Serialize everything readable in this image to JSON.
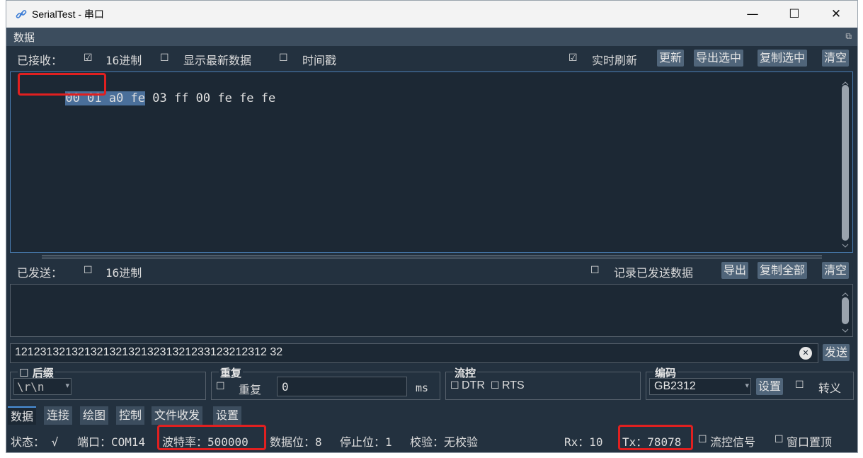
{
  "window": {
    "title": "SerialTest - 串口",
    "minimize": "—",
    "maximize": "☐",
    "close": "✕"
  },
  "dock": {
    "title": "数据",
    "undock": "⧉"
  },
  "received": {
    "label": "已接收：",
    "hex_checkbox": "☑",
    "hex_label": "16进制",
    "latest_checkbox": "☐",
    "latest_label": "显示最新数据",
    "timestamp_checkbox": "☐",
    "timestamp_label": "时间戳",
    "realtime_checkbox": "☑",
    "realtime_label": "实时刷新",
    "btn_update": "更新",
    "btn_export_sel": "导出选中",
    "btn_copy_sel": "复制选中",
    "btn_clear": "清空",
    "selected_text": "00 01 a0 fe",
    "rest_text": " 03 ff 00 fe fe fe"
  },
  "sent": {
    "label": "已发送：",
    "hex_checkbox": "☐",
    "hex_label": "16进制",
    "record_checkbox": "☐",
    "record_label": "记录已发送数据",
    "btn_export": "导出",
    "btn_copy_all": "复制全部",
    "btn_clear": "清空"
  },
  "input": {
    "value": "1212313213213213213213231321233123212312 32",
    "clear_icon": "✕",
    "send": "发送"
  },
  "suffix": {
    "checkbox": "☐",
    "title": "后缀",
    "value": "\\r\\n",
    "arrow": "▾"
  },
  "repeat": {
    "title": "重复",
    "checkbox": "☐",
    "label": "重复",
    "value": "0",
    "unit": "ms"
  },
  "flow": {
    "title": "流控",
    "dtr_checkbox": "☐",
    "dtr": "DTR",
    "rts_checkbox": "☐",
    "rts": "RTS"
  },
  "encoding": {
    "title": "编码",
    "value": "GB2312",
    "arrow": "▾",
    "btn_set": "设置",
    "escape_checkbox": "☐",
    "escape_label": "转义"
  },
  "tabs": [
    "数据",
    "连接",
    "绘图",
    "控制",
    "文件收发",
    "设置"
  ],
  "status": {
    "state": "状态： √",
    "port": "端口：COM14",
    "baud": "波特率：500000",
    "databits": "数据位：8",
    "stopbits": "停止位：1",
    "parity": "校验：无校验",
    "rx": "Rx：10",
    "tx": "Tx：78078",
    "flow_checkbox": "☐",
    "flow_signal": "流控信号",
    "top_checkbox": "☐",
    "top": "窗口置顶"
  },
  "colors": {
    "accent": "#4a90d9",
    "highlight": "#e02020",
    "background": "#23313f"
  }
}
